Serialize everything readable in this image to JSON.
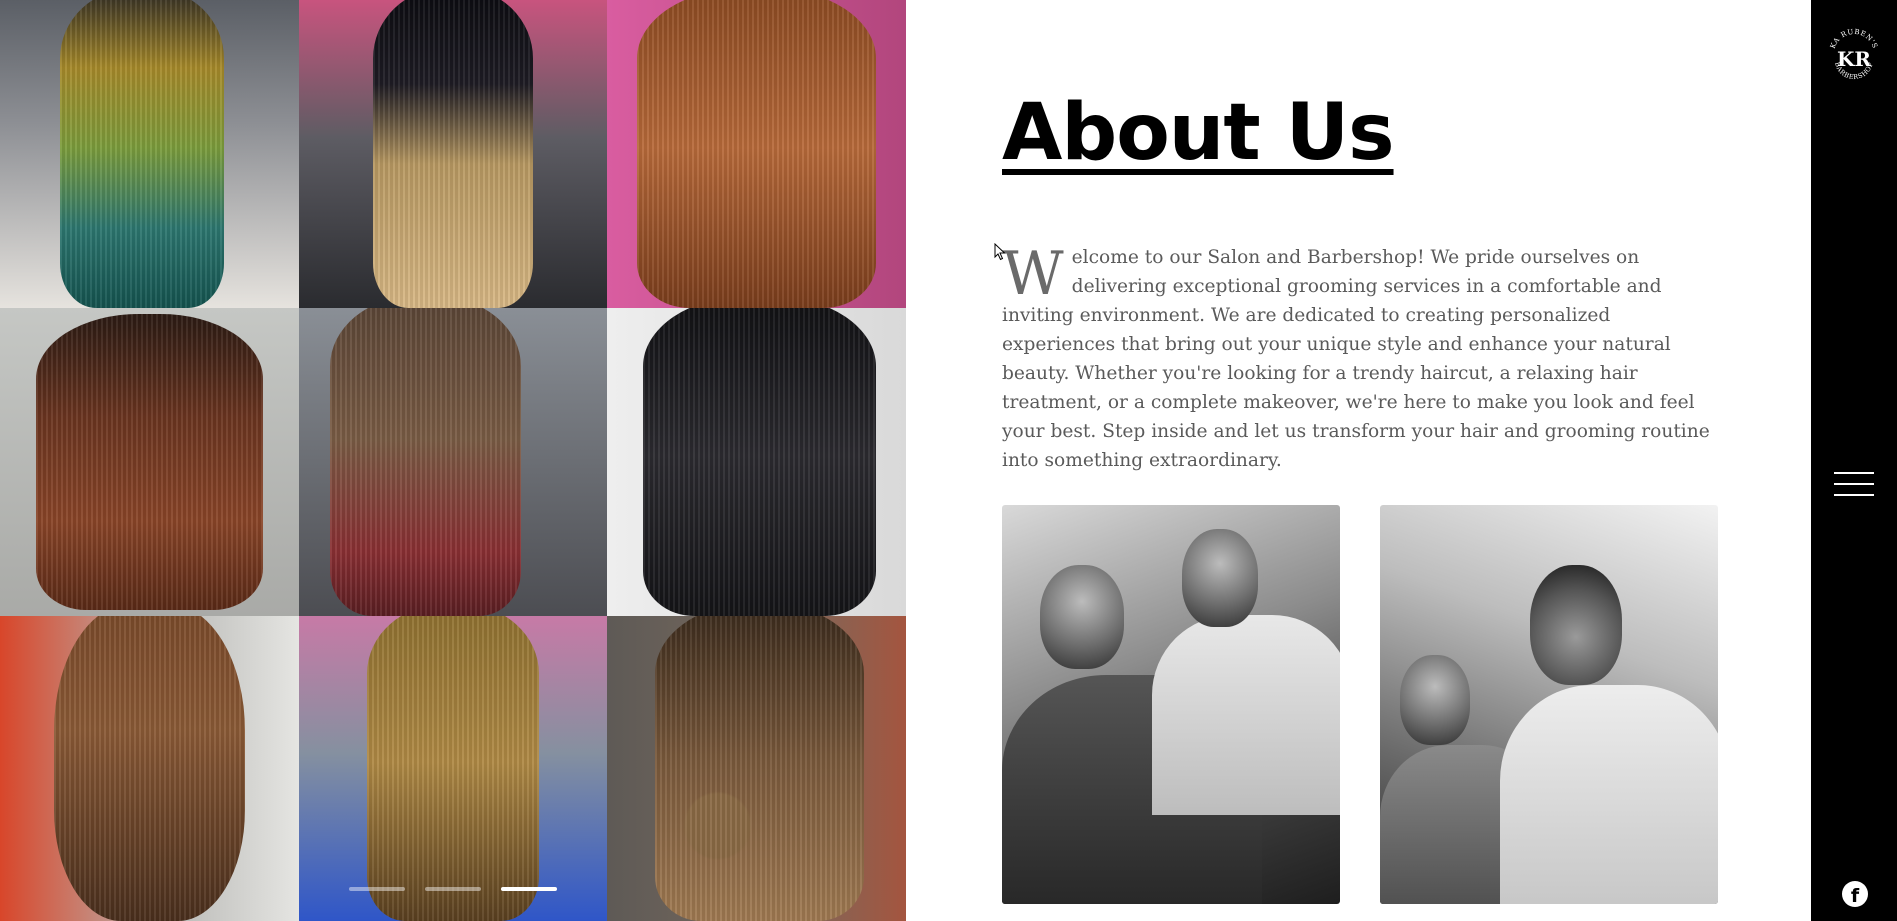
{
  "gallery": {
    "tile_count": 9,
    "slider": {
      "slide_count": 3,
      "active_index": 2
    }
  },
  "about": {
    "title": "About Us",
    "intro_first_letter": "W",
    "intro_rest": "elcome to our Salon and Barbershop! We pride ourselves on delivering exceptional grooming services in a comfortable and inviting environment. We are dedicated to creating personalized experiences that bring out your unique style and enhance your natural beauty. Whether you're looking for a trendy haircut, a relaxing hair treatment, or a complete makeover, we're here to make you look and feel your best. Step inside and let us transform your hair and grooming routine into something extraordinary."
  },
  "sidebar": {
    "logo": {
      "icon": "barbershop-logo-icon",
      "top_text": "KA RUBEN'S",
      "monogram": "KR",
      "bottom_text": "BARBERSHOP"
    },
    "menu_icon": "hamburger-menu-icon",
    "social_icon": "facebook-icon",
    "social_glyph": "f"
  },
  "colors": {
    "sidebar_bg": "#000000",
    "heading": "#000000",
    "body_text": "#5a5a5a",
    "background": "#ffffff"
  }
}
